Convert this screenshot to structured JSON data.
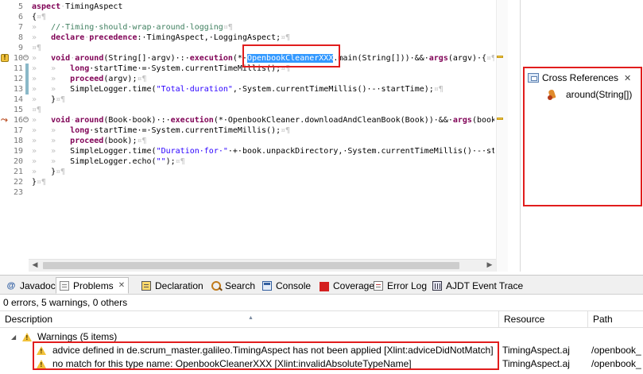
{
  "editor": {
    "lines": [
      {
        "num": "5",
        "tokens": [
          [
            "kw",
            "aspect"
          ],
          [
            "ws",
            "·"
          ],
          [
            "",
            "TimingAspect"
          ]
        ]
      },
      {
        "num": "6",
        "tokens": [
          [
            "",
            "{"
          ],
          [
            "ws",
            "¤¶"
          ]
        ]
      },
      {
        "num": "7",
        "tokens": [
          [
            "ws",
            "»   "
          ],
          [
            "cm",
            "//·Timing·should·wrap·around·logging"
          ],
          [
            "ws",
            "¤¶"
          ]
        ]
      },
      {
        "num": "8",
        "tokens": [
          [
            "ws",
            "»   "
          ],
          [
            "kw",
            "declare"
          ],
          [
            "ws",
            "·"
          ],
          [
            "kw",
            "precedence"
          ],
          [
            "",
            ":·TimingAspect,·LoggingAspect;"
          ],
          [
            "ws",
            "¤¶"
          ]
        ]
      },
      {
        "num": "9",
        "tokens": [
          [
            "ws",
            "¤¶"
          ]
        ]
      },
      {
        "num": "10",
        "tokens": [
          [
            "ws",
            "»   "
          ],
          [
            "kw",
            "void"
          ],
          [
            "ws",
            "·"
          ],
          [
            "kw",
            "around"
          ],
          [
            "",
            "(String[]·argv)·:·"
          ],
          [
            "kw",
            "execution"
          ],
          [
            "",
            "(*·"
          ],
          [
            "sel",
            "OpenbookCleanerXXX"
          ],
          [
            "",
            ".main(String[]))·&&·"
          ],
          [
            "kw",
            "args"
          ],
          [
            "",
            "(argv)·{"
          ],
          [
            "ws",
            "¤¶"
          ]
        ]
      },
      {
        "num": "11",
        "tokens": [
          [
            "ws",
            "»   »   "
          ],
          [
            "kw",
            "long"
          ],
          [
            "",
            "·startTime·=·System."
          ],
          [
            "",
            "currentTimeMillis"
          ],
          [
            "",
            "();"
          ],
          [
            "ws",
            "¤¶"
          ]
        ]
      },
      {
        "num": "12",
        "tokens": [
          [
            "ws",
            "»   »   "
          ],
          [
            "kw",
            "proceed"
          ],
          [
            "",
            "(argv);"
          ],
          [
            "ws",
            "¤¶"
          ]
        ]
      },
      {
        "num": "13",
        "tokens": [
          [
            "ws",
            "»   »   "
          ],
          [
            "",
            "SimpleLogger."
          ],
          [
            "",
            "time"
          ],
          [
            "",
            "("
          ],
          [
            "str",
            "\"Total·duration\""
          ],
          [
            "",
            ",·System."
          ],
          [
            "",
            "currentTimeMillis"
          ],
          [
            "",
            "()·-·startTime);"
          ],
          [
            "ws",
            "¤¶"
          ]
        ]
      },
      {
        "num": "14",
        "tokens": [
          [
            "ws",
            "»   "
          ],
          [
            "",
            "}"
          ],
          [
            "ws",
            "¤¶"
          ]
        ]
      },
      {
        "num": "15",
        "tokens": [
          [
            "ws",
            "¤¶"
          ]
        ]
      },
      {
        "num": "16",
        "tokens": [
          [
            "ws",
            "»   "
          ],
          [
            "kw",
            "void"
          ],
          [
            "ws",
            "·"
          ],
          [
            "kw",
            "around"
          ],
          [
            "",
            "(Book·book)·:·"
          ],
          [
            "kw",
            "execution"
          ],
          [
            "",
            "(*·OpenbookCleaner.downloadAndCleanBook(Book))·&&·"
          ],
          [
            "kw",
            "args"
          ],
          [
            "",
            "(book"
          ]
        ]
      },
      {
        "num": "17",
        "tokens": [
          [
            "ws",
            "»   »   "
          ],
          [
            "kw",
            "long"
          ],
          [
            "",
            "·startTime·=·System."
          ],
          [
            "",
            "currentTimeMillis"
          ],
          [
            "",
            "();"
          ],
          [
            "ws",
            "¤¶"
          ]
        ]
      },
      {
        "num": "18",
        "tokens": [
          [
            "ws",
            "»   »   "
          ],
          [
            "kw",
            "proceed"
          ],
          [
            "",
            "(book);"
          ],
          [
            "ws",
            "¤¶"
          ]
        ]
      },
      {
        "num": "19",
        "tokens": [
          [
            "ws",
            "»   »   "
          ],
          [
            "",
            "SimpleLogger."
          ],
          [
            "",
            "time"
          ],
          [
            "",
            "("
          ],
          [
            "str",
            "\"Duration·for·\""
          ],
          [
            "",
            "·+·book.unpackDirectory,·System."
          ],
          [
            "",
            "currentTimeMillis"
          ],
          [
            "",
            "()·-·st"
          ]
        ]
      },
      {
        "num": "20",
        "tokens": [
          [
            "ws",
            "»   »   "
          ],
          [
            "",
            "SimpleLogger."
          ],
          [
            "",
            "echo"
          ],
          [
            "",
            "("
          ],
          [
            "str",
            "\"\""
          ],
          [
            "",
            ");"
          ],
          [
            "ws",
            "¤¶"
          ]
        ]
      },
      {
        "num": "21",
        "tokens": [
          [
            "ws",
            "»   "
          ],
          [
            "",
            "}"
          ],
          [
            "ws",
            "¤¶"
          ]
        ]
      },
      {
        "num": "22",
        "tokens": [
          [
            "",
            "}"
          ],
          [
            "ws",
            "¤¶"
          ]
        ]
      },
      {
        "num": "23",
        "tokens": [
          [
            "ws",
            ""
          ]
        ]
      }
    ]
  },
  "cross_references": {
    "title": "Cross References",
    "item_label": "around(String[])"
  },
  "bottom_tabs": [
    {
      "label": "Javadoc",
      "icon": "javadoc-icon"
    },
    {
      "label": "Problems",
      "icon": "problems-icon",
      "active": true
    },
    {
      "label": "Declaration",
      "icon": "declaration-icon"
    },
    {
      "label": "Search",
      "icon": "search-icon"
    },
    {
      "label": "Console",
      "icon": "console-icon"
    },
    {
      "label": "Coverage",
      "icon": "coverage-icon"
    },
    {
      "label": "Error Log",
      "icon": "error-log-icon"
    },
    {
      "label": "AJDT Event Trace",
      "icon": "ajdt-event-trace-icon"
    }
  ],
  "problems": {
    "summary": "0 errors, 5 warnings, 0 others",
    "columns": [
      "Description",
      "Resource",
      "Path"
    ],
    "group_label": "Warnings (5 items)",
    "rows": [
      {
        "description": "advice defined in de.scrum_master.galileo.TimingAspect has not been applied [Xlint:adviceDidNotMatch]",
        "resource": "TimingAspect.aj",
        "path": "/openbook_"
      },
      {
        "description": "no match for this type name: OpenbookCleanerXXX [Xlint:invalidAbsoluteTypeName]",
        "resource": "TimingAspect.aj",
        "path": "/openbook_"
      }
    ]
  }
}
